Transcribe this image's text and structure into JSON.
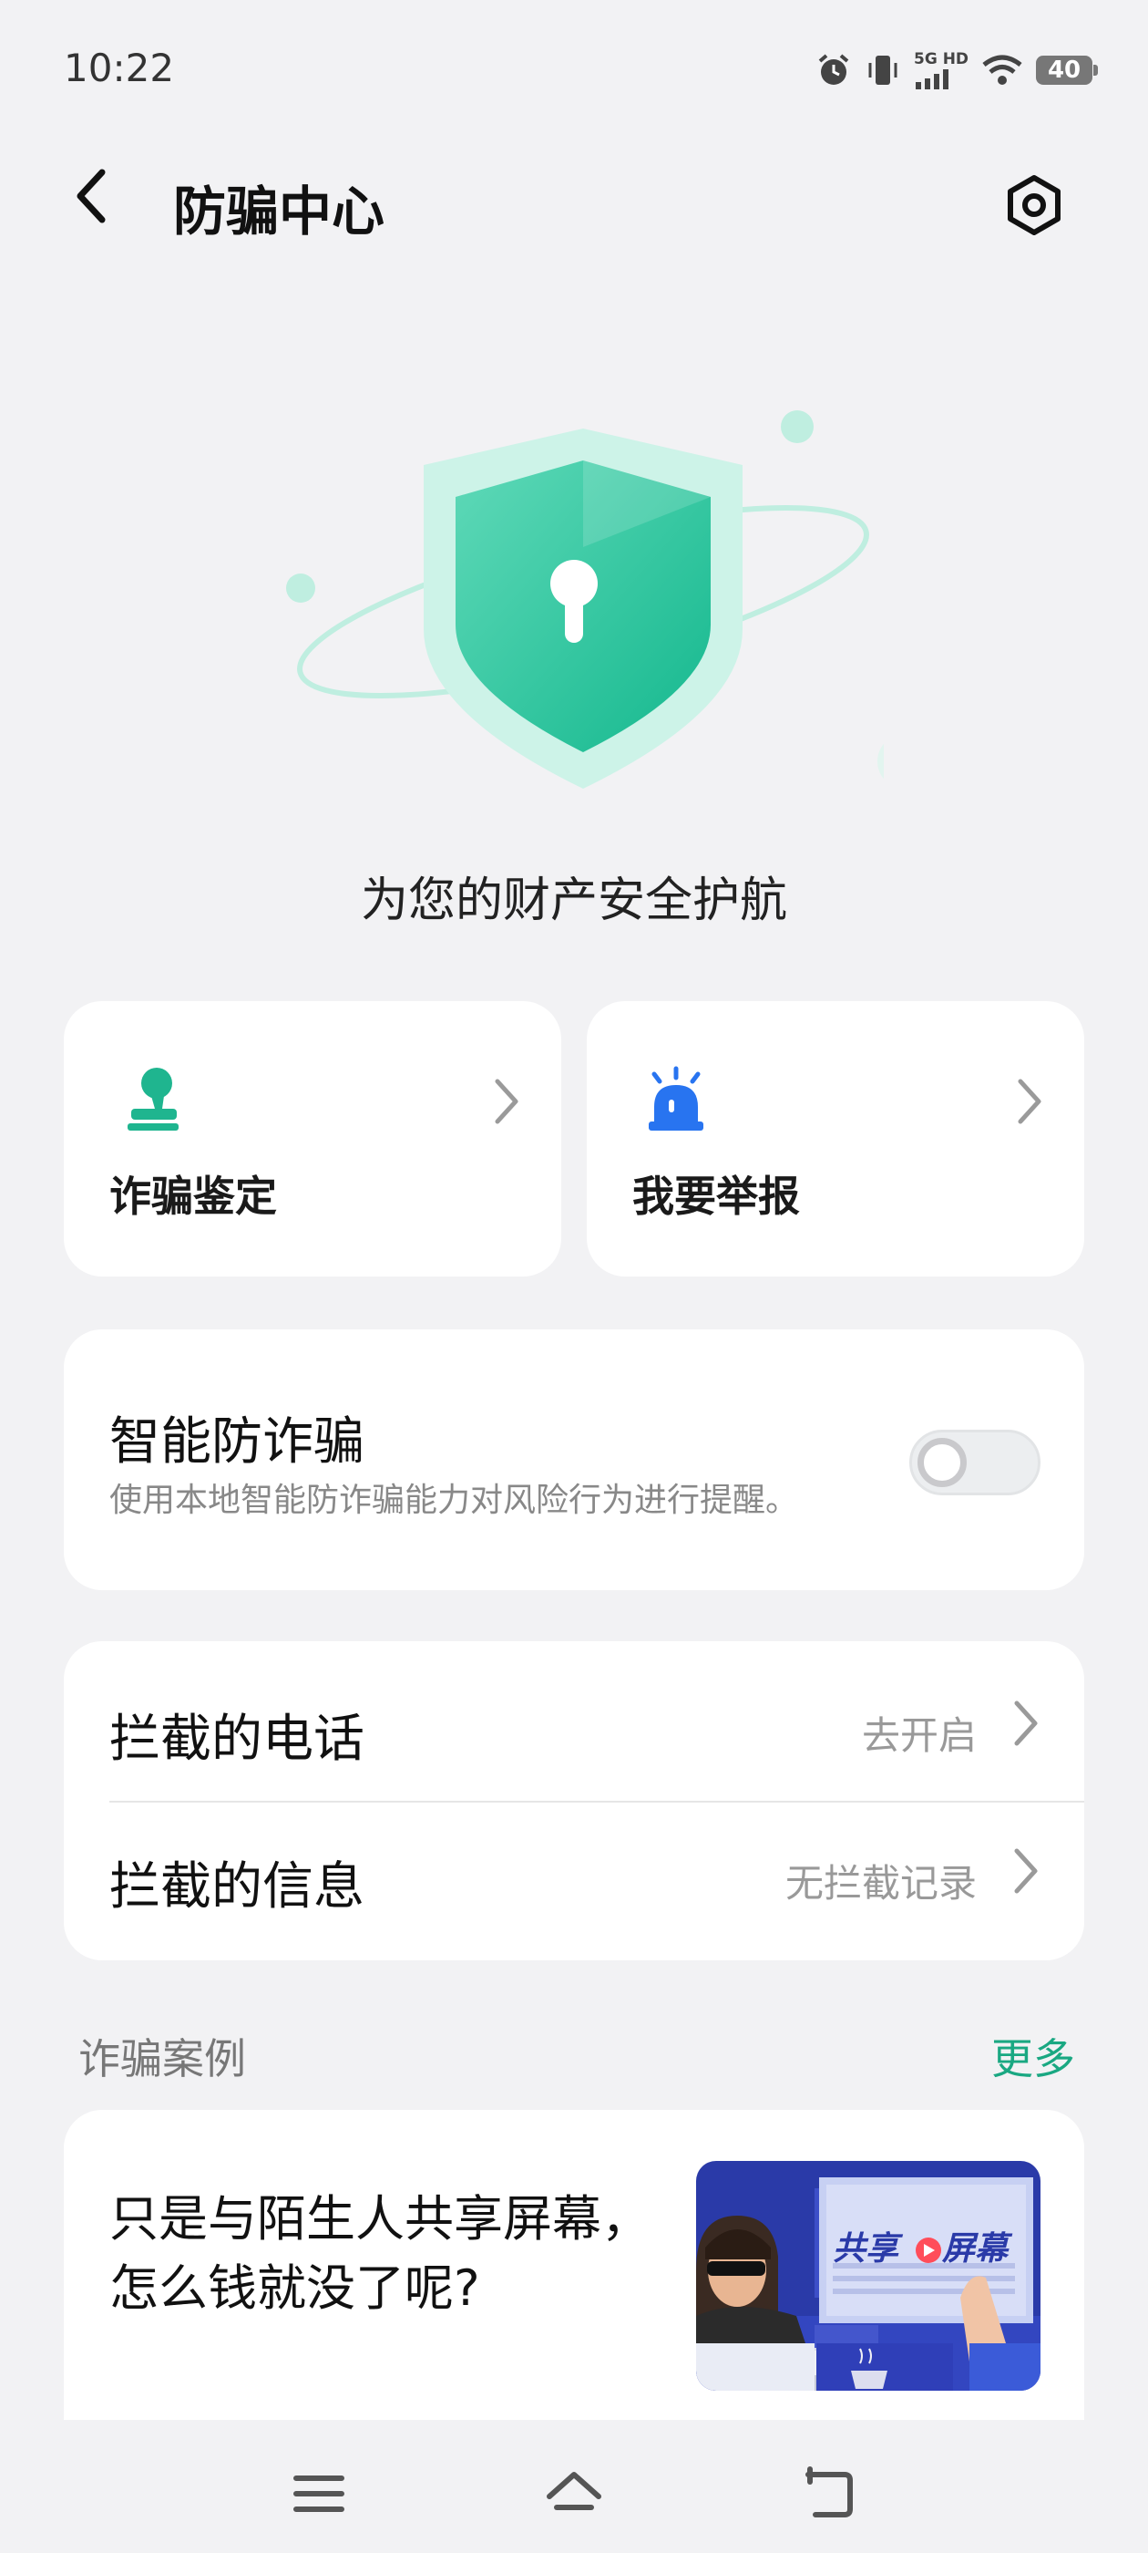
{
  "status": {
    "time": "10:22",
    "network": "5G HD",
    "battery": "40"
  },
  "header": {
    "title": "防骗中心"
  },
  "hero": {
    "tagline": "为您的财产安全护航"
  },
  "quick_actions": [
    {
      "label": "诈骗鉴定",
      "icon": "stamp-icon",
      "color": "#1fb58f"
    },
    {
      "label": "我要举报",
      "icon": "alarm-siren-icon",
      "color": "#2874f0"
    }
  ],
  "smart_protection": {
    "title": "智能防诈骗",
    "description": "使用本地智能防诈骗能力对风险行为进行提醒。",
    "enabled": false
  },
  "intercept": {
    "calls": {
      "label": "拦截的电话",
      "value": "去开启"
    },
    "messages": {
      "label": "拦截的信息",
      "value": "无拦截记录"
    }
  },
  "cases": {
    "title": "诈骗案例",
    "more": "更多",
    "items": [
      {
        "title": "只是与陌生人共享屏幕，怎么钱就没了呢?",
        "thumb_text": "共享屏幕"
      }
    ]
  },
  "colors": {
    "accent": "#1aa882",
    "background": "#f2f2f4",
    "report_blue": "#2874f0"
  }
}
